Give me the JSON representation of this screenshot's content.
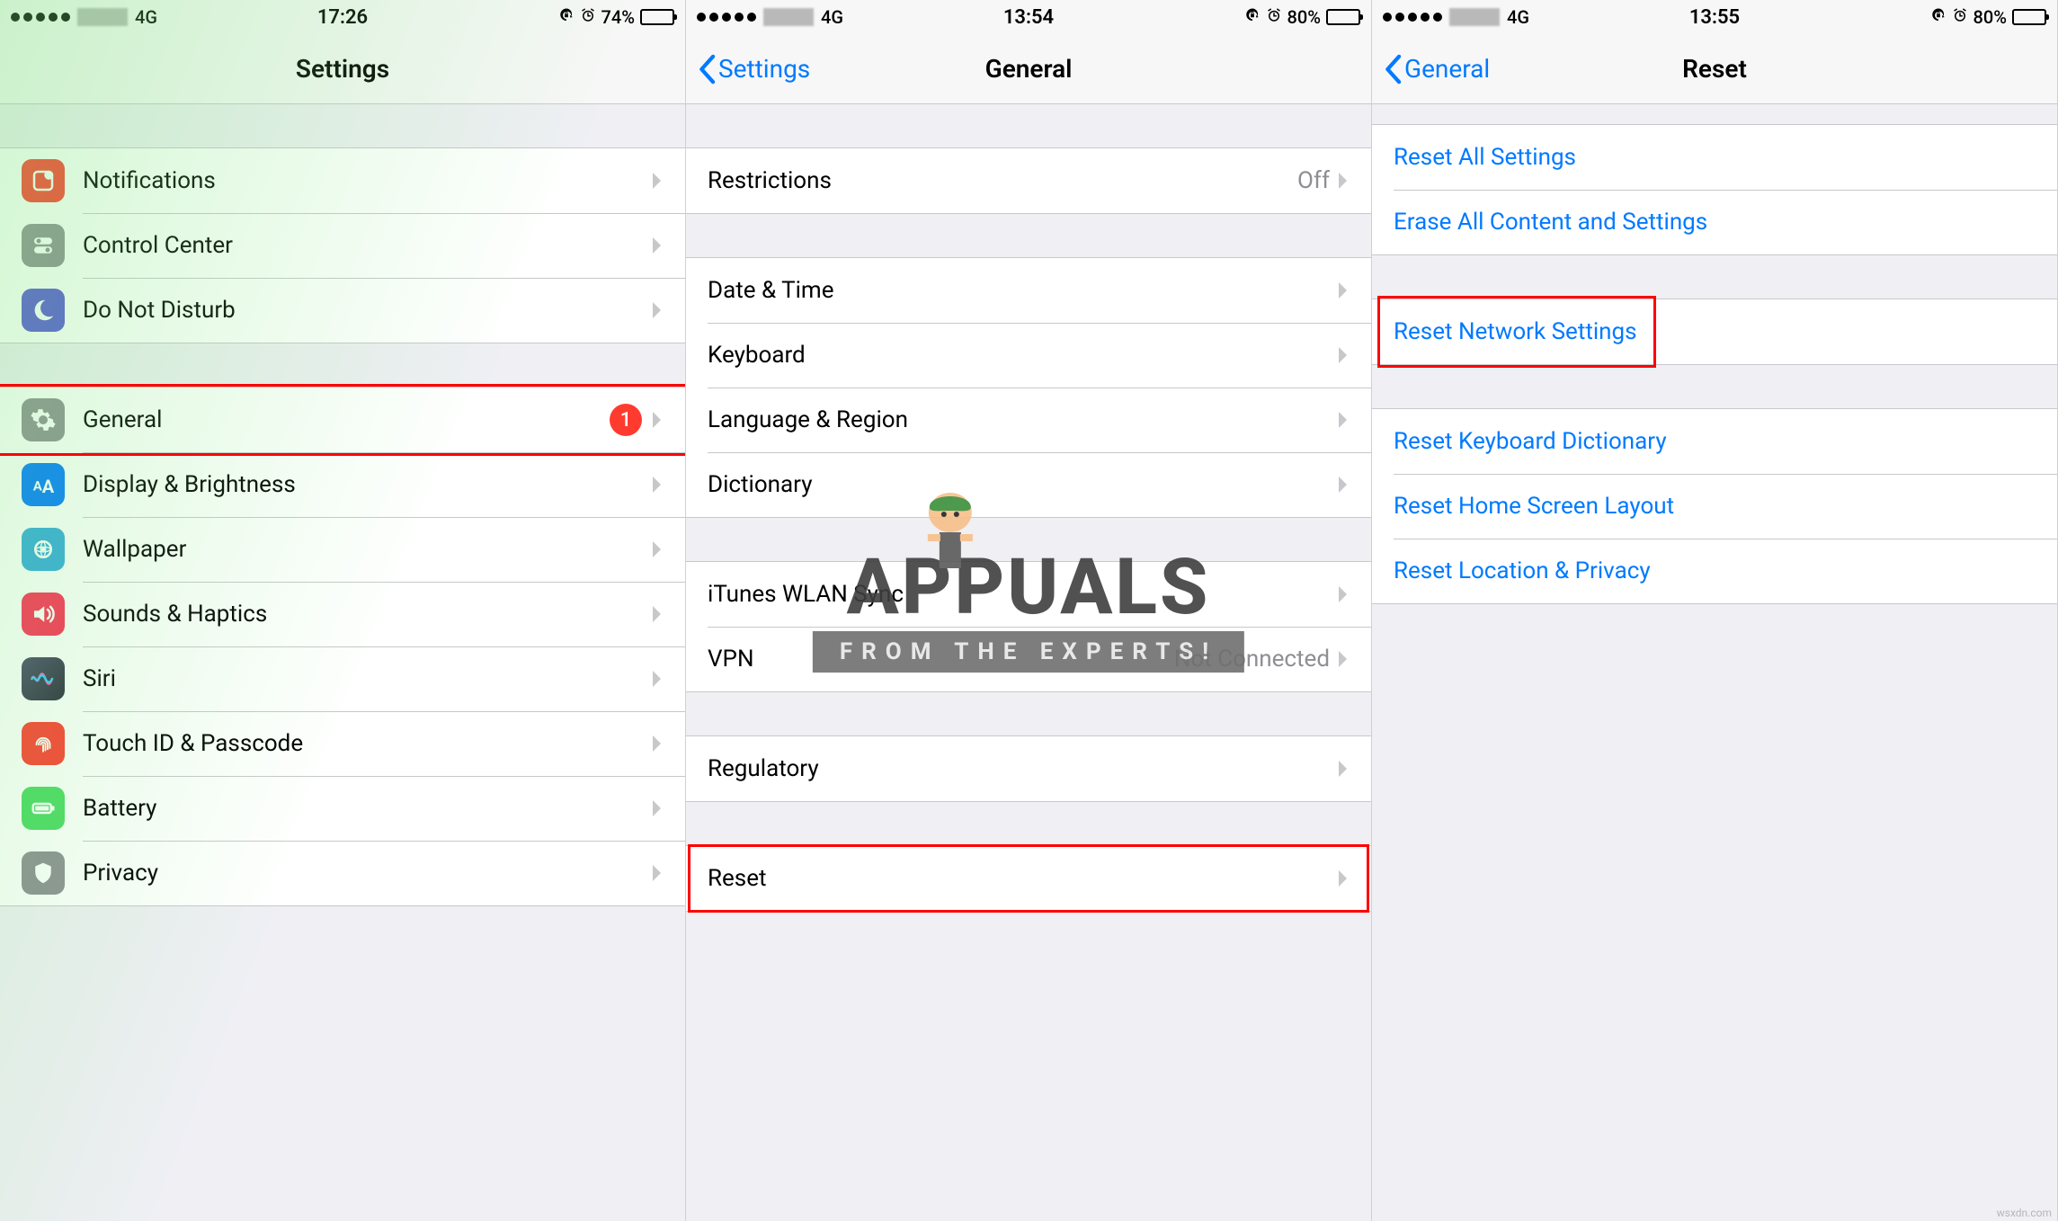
{
  "watermark_source": "wsxdn.com",
  "appuals": {
    "brand": "APPUALS",
    "tag": "FROM THE EXPERTS!"
  },
  "screens": [
    {
      "status": {
        "signal": "4G",
        "time": "17:26",
        "battery_pct": "74%",
        "battery_fill": 74
      },
      "nav": {
        "title": "Settings",
        "back": null
      },
      "groups": [
        {
          "gap": "tall",
          "cells": [
            {
              "icon": "notifications",
              "icon_bg": "#ff3b30",
              "label": "Notifications"
            },
            {
              "icon": "control-center",
              "icon_bg": "#8e8e93",
              "label": "Control Center"
            },
            {
              "icon": "moon",
              "icon_bg": "#5856d6",
              "label": "Do Not Disturb"
            }
          ]
        },
        {
          "gap": "tall",
          "cells": [
            {
              "icon": "gear",
              "icon_bg": "#8e8e93",
              "label": "General",
              "badge": "1",
              "highlight": true
            },
            {
              "icon": "display",
              "icon_bg": "#007aff",
              "label": "Display & Brightness"
            },
            {
              "icon": "wallpaper",
              "icon_bg": "#34aadc",
              "label": "Wallpaper"
            },
            {
              "icon": "sounds",
              "icon_bg": "#ff2d55",
              "label": "Sounds & Haptics"
            },
            {
              "icon": "siri",
              "icon_bg": "#000",
              "label": "Siri"
            },
            {
              "icon": "touchid",
              "icon_bg": "#ff3b30",
              "label": "Touch ID & Passcode"
            },
            {
              "icon": "battery",
              "icon_bg": "#4cd964",
              "label": "Battery"
            },
            {
              "icon": "privacy",
              "icon_bg": "#8e8e93",
              "label": "Privacy"
            }
          ]
        }
      ]
    },
    {
      "status": {
        "signal": "4G",
        "time": "13:54",
        "battery_pct": "80%",
        "battery_fill": 80
      },
      "nav": {
        "title": "General",
        "back": "Settings"
      },
      "groups": [
        {
          "gap": "tall",
          "cells": [
            {
              "label": "Restrictions",
              "value": "Off"
            }
          ]
        },
        {
          "gap": "tall",
          "cells": [
            {
              "label": "Date & Time"
            },
            {
              "label": "Keyboard"
            },
            {
              "label": "Language & Region"
            },
            {
              "label": "Dictionary"
            }
          ]
        },
        {
          "gap": "tall",
          "cells": [
            {
              "label": "iTunes WLAN Sync"
            },
            {
              "label": "VPN",
              "value": "Not Connected"
            }
          ]
        },
        {
          "gap": "tall",
          "cells": [
            {
              "label": "Regulatory"
            }
          ]
        },
        {
          "gap": "tall",
          "cells": [
            {
              "label": "Reset",
              "highlight": true
            }
          ]
        }
      ]
    },
    {
      "status": {
        "signal": "4G",
        "time": "13:55",
        "battery_pct": "80%",
        "battery_fill": 80
      },
      "nav": {
        "title": "Reset",
        "back": "General"
      },
      "groups": [
        {
          "gap": "tall",
          "cells": [
            {
              "label": "Reset All Settings",
              "link": true
            },
            {
              "label": "Erase All Content and Settings",
              "link": true
            }
          ]
        },
        {
          "gap": "tall",
          "cells": [
            {
              "label": "Reset Network Settings",
              "link": true,
              "highlight": true
            }
          ]
        },
        {
          "gap": "tall",
          "cells": [
            {
              "label": "Reset Keyboard Dictionary",
              "link": true
            },
            {
              "label": "Reset Home Screen Layout",
              "link": true
            },
            {
              "label": "Reset Location & Privacy",
              "link": true
            }
          ]
        }
      ]
    }
  ]
}
